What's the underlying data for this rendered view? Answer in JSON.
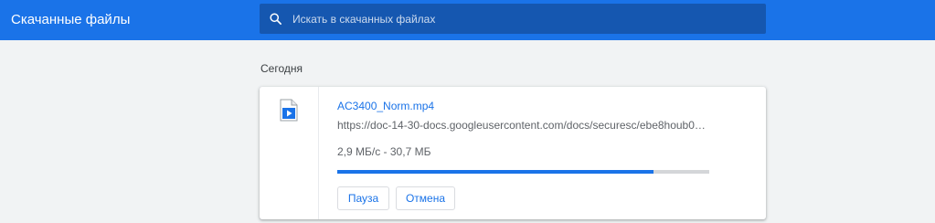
{
  "toolbar": {
    "title": "Скачанные файлы",
    "search_placeholder": "Искать в скачанных файлах",
    "search_icon": "search-icon"
  },
  "section": {
    "date_label": "Сегодня"
  },
  "download": {
    "file_icon": "video-file-icon",
    "file_name": "AC3400_Norm.mp4",
    "url": "https://doc-14-30-docs.googleusercontent.com/docs/securesc/ebe8houb0ljj1f7qj8e...",
    "status": "2,9 МБ/с - 30,7 МБ",
    "progress_percent": 85,
    "pause_label": "Пауза",
    "cancel_label": "Отмена"
  },
  "colors": {
    "accent": "#1a73e8",
    "toolbar_bg": "#1a73e8",
    "search_bg": "#1557b0",
    "page_bg": "#f1f3f4"
  }
}
